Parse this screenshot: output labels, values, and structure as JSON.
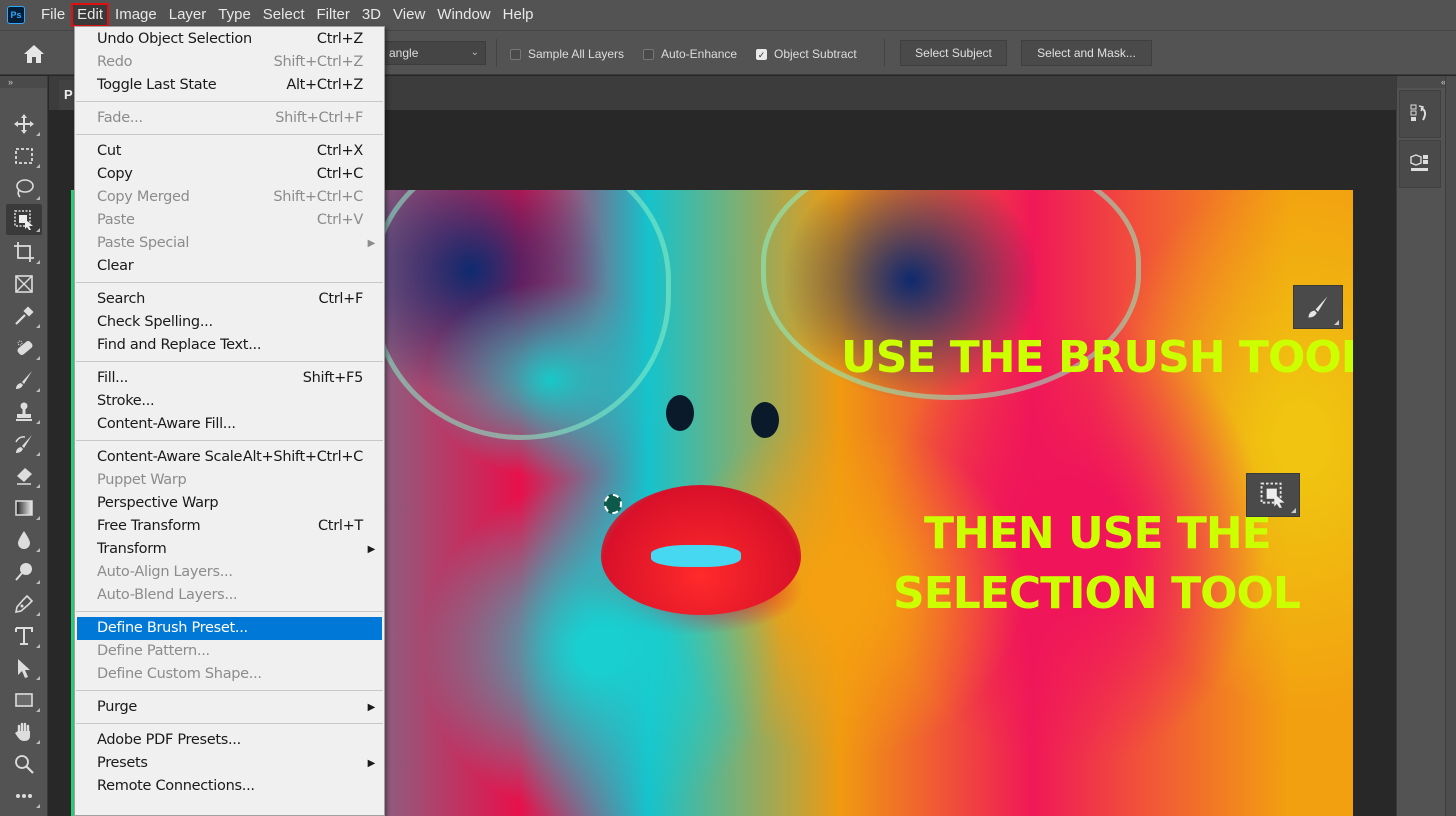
{
  "app": {
    "name": "Photoshop",
    "logo_text": "Ps"
  },
  "menubar": {
    "items": [
      "File",
      "Edit",
      "Image",
      "Layer",
      "Type",
      "Select",
      "Filter",
      "3D",
      "View",
      "Window",
      "Help"
    ],
    "active": "Edit"
  },
  "options_bar": {
    "mode_select_value": "angle",
    "checkboxes": [
      {
        "label": "Sample All Layers",
        "checked": false
      },
      {
        "label": "Auto-Enhance",
        "checked": false
      },
      {
        "label": "Object Subtract",
        "checked": true
      }
    ],
    "buttons": [
      "Select Subject",
      "Select and Mask..."
    ]
  },
  "document": {
    "tab_label": "P"
  },
  "edit_menu": {
    "groups": [
      [
        {
          "label": "Undo Object Selection",
          "shortcut": "Ctrl+Z",
          "disabled": false
        },
        {
          "label": "Redo",
          "shortcut": "Shift+Ctrl+Z",
          "disabled": true
        },
        {
          "label": "Toggle Last State",
          "shortcut": "Alt+Ctrl+Z",
          "disabled": false
        }
      ],
      [
        {
          "label": "Fade...",
          "shortcut": "Shift+Ctrl+F",
          "disabled": true
        }
      ],
      [
        {
          "label": "Cut",
          "shortcut": "Ctrl+X",
          "disabled": false
        },
        {
          "label": "Copy",
          "shortcut": "Ctrl+C",
          "disabled": false
        },
        {
          "label": "Copy Merged",
          "shortcut": "Shift+Ctrl+C",
          "disabled": true
        },
        {
          "label": "Paste",
          "shortcut": "Ctrl+V",
          "disabled": true
        },
        {
          "label": "Paste Special",
          "shortcut": "",
          "disabled": true,
          "submenu": true
        },
        {
          "label": "Clear",
          "shortcut": "",
          "disabled": false
        }
      ],
      [
        {
          "label": "Search",
          "shortcut": "Ctrl+F",
          "disabled": false
        },
        {
          "label": "Check Spelling...",
          "shortcut": "",
          "disabled": false
        },
        {
          "label": "Find and Replace Text...",
          "shortcut": "",
          "disabled": false
        }
      ],
      [
        {
          "label": "Fill...",
          "shortcut": "Shift+F5",
          "disabled": false
        },
        {
          "label": "Stroke...",
          "shortcut": "",
          "disabled": false
        },
        {
          "label": "Content-Aware Fill...",
          "shortcut": "",
          "disabled": false
        }
      ],
      [
        {
          "label": "Content-Aware Scale",
          "shortcut": "Alt+Shift+Ctrl+C",
          "disabled": false
        },
        {
          "label": "Puppet Warp",
          "shortcut": "",
          "disabled": true
        },
        {
          "label": "Perspective Warp",
          "shortcut": "",
          "disabled": false
        },
        {
          "label": "Free Transform",
          "shortcut": "Ctrl+T",
          "disabled": false
        },
        {
          "label": "Transform",
          "shortcut": "",
          "disabled": false,
          "submenu": true
        },
        {
          "label": "Auto-Align Layers...",
          "shortcut": "",
          "disabled": true
        },
        {
          "label": "Auto-Blend Layers...",
          "shortcut": "",
          "disabled": true
        }
      ],
      [
        {
          "label": "Define Brush Preset...",
          "shortcut": "",
          "disabled": false,
          "highlighted": true
        },
        {
          "label": "Define Pattern...",
          "shortcut": "",
          "disabled": true
        },
        {
          "label": "Define Custom Shape...",
          "shortcut": "",
          "disabled": true
        }
      ],
      [
        {
          "label": "Purge",
          "shortcut": "",
          "disabled": false,
          "submenu": true
        }
      ],
      [
        {
          "label": "Adobe PDF Presets...",
          "shortcut": "",
          "disabled": false
        },
        {
          "label": "Presets",
          "shortcut": "",
          "disabled": false,
          "submenu": true
        },
        {
          "label": "Remote Connections...",
          "shortcut": "",
          "disabled": false
        }
      ]
    ]
  },
  "tools": [
    "move-tool",
    "marquee-tool",
    "lasso-tool",
    "object-selection-tool",
    "crop-tool",
    "frame-tool",
    "eyedropper-tool",
    "healing-brush-tool",
    "brush-tool",
    "clone-stamp-tool",
    "history-brush-tool",
    "eraser-tool",
    "gradient-tool",
    "blur-tool",
    "dodge-tool",
    "pen-tool",
    "type-tool",
    "path-selection-tool",
    "rectangle-tool",
    "hand-tool",
    "zoom-tool",
    "more-tools"
  ],
  "selected_tool": "object-selection-tool",
  "canvas_overlay": {
    "line1": "USE THE BRUSH TOOL",
    "line2": "THEN USE THE",
    "line3": "SELECTION TOOL",
    "text_color": "#ccff00"
  },
  "colors": {
    "highlight": "#0078d7",
    "active_menu_border": "#e01010"
  }
}
